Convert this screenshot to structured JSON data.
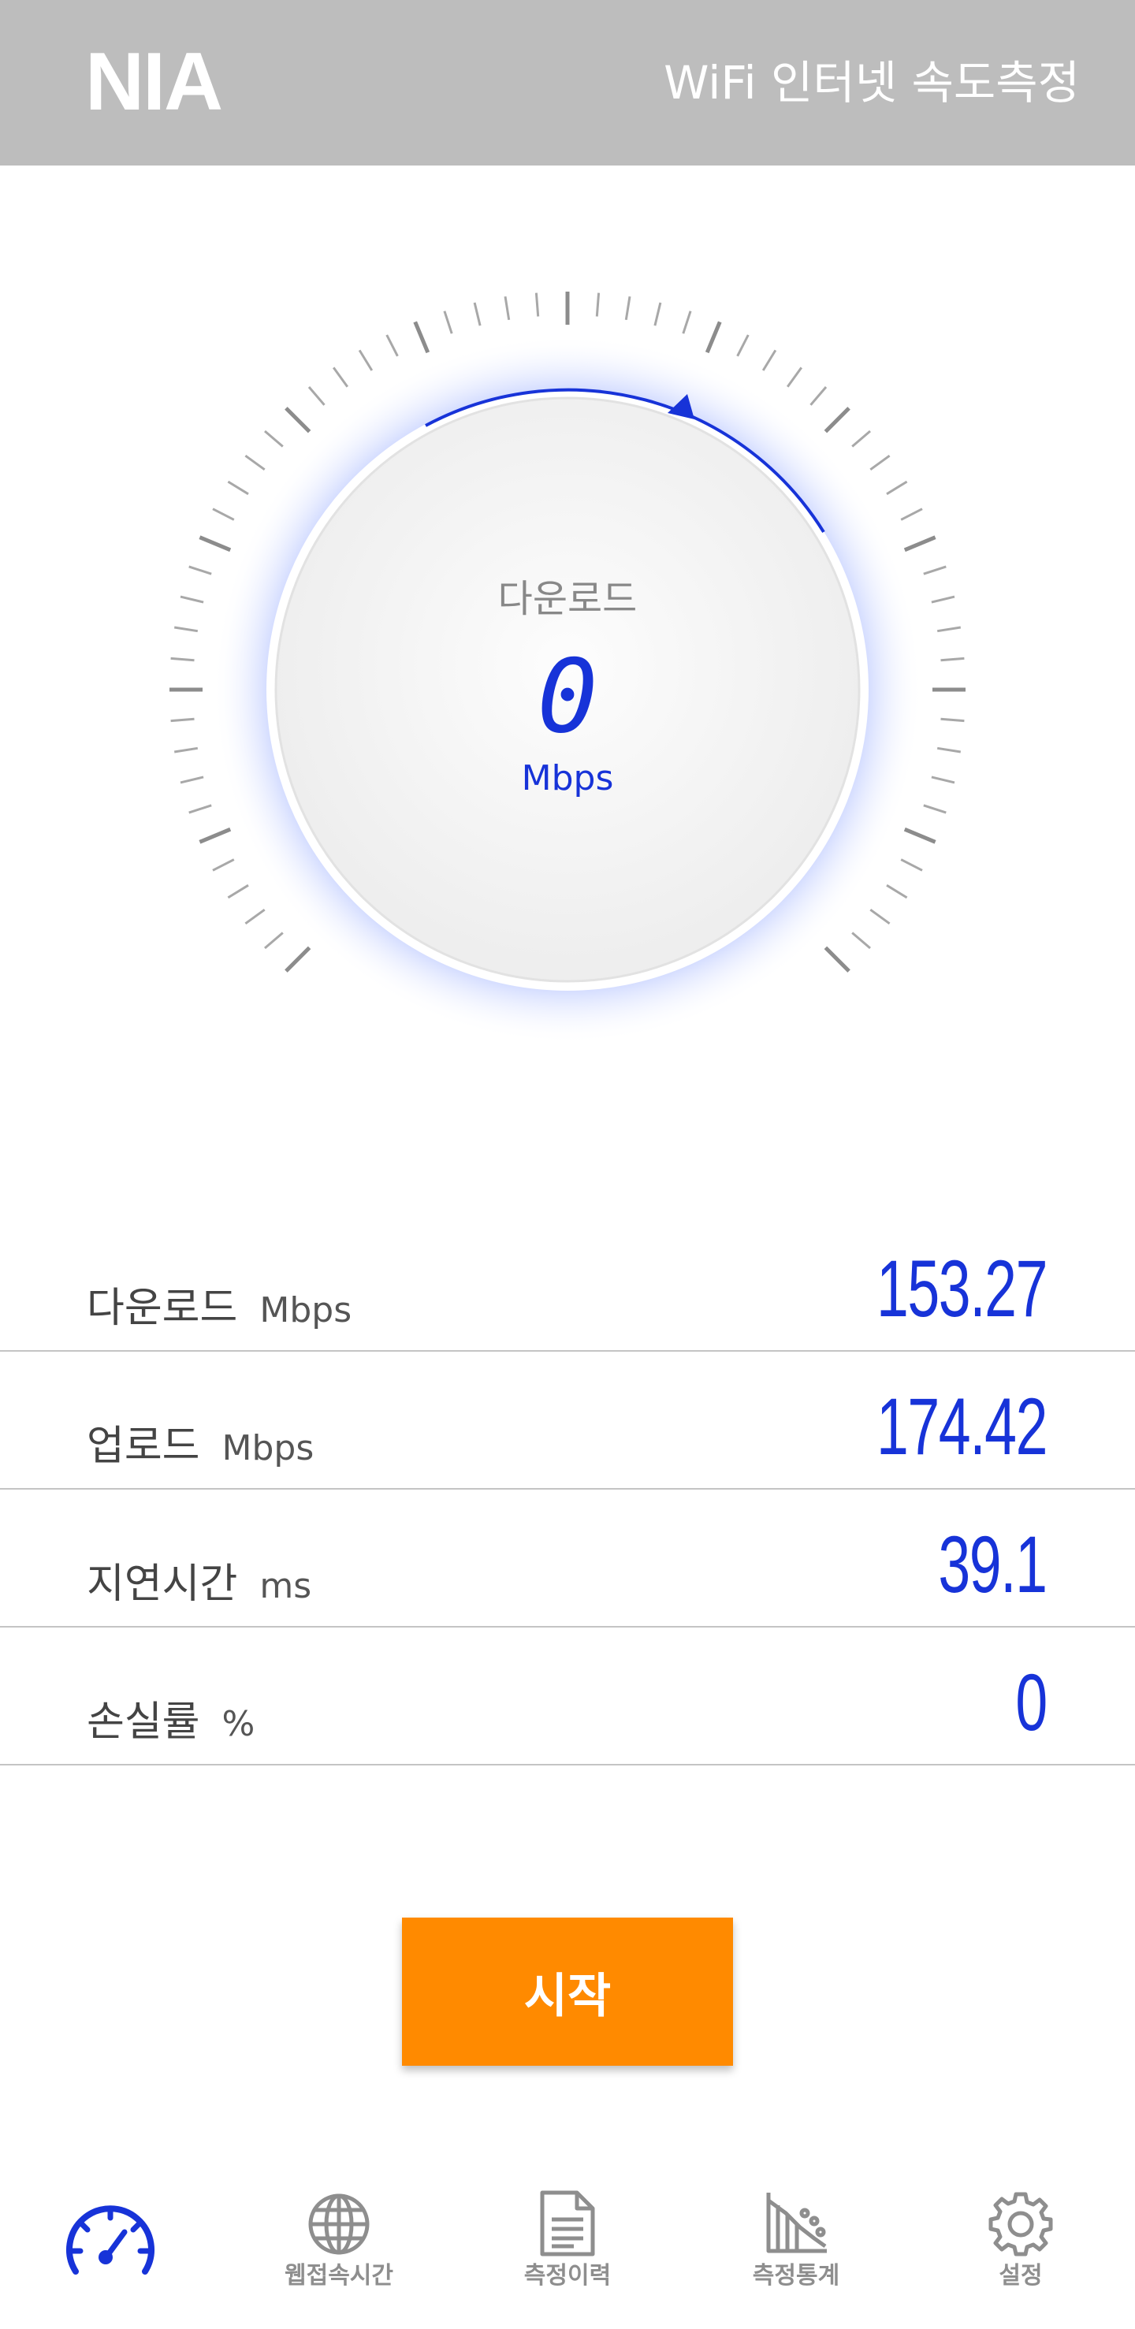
{
  "header": {
    "logo": "NIA",
    "title": "WiFi 인터넷 속도측정"
  },
  "gauge": {
    "label": "다운로드",
    "value": "0",
    "unit": "Mbps"
  },
  "results": [
    {
      "label": "다운로드",
      "unit": "Mbps",
      "value": "153.27"
    },
    {
      "label": "업로드",
      "unit": "Mbps",
      "value": "174.42"
    },
    {
      "label": "지연시간",
      "unit": "ms",
      "value": "39.1"
    },
    {
      "label": "손실률",
      "unit": "%",
      "value": "0"
    }
  ],
  "start_button": "시작",
  "nav": [
    {
      "label": "",
      "icon": "speedometer-icon",
      "active": true
    },
    {
      "label": "웹접속시간",
      "icon": "globe-icon"
    },
    {
      "label": "측정이력",
      "icon": "document-icon"
    },
    {
      "label": "측정통계",
      "icon": "statistics-icon"
    },
    {
      "label": "설정",
      "icon": "gear-icon"
    }
  ],
  "colors": {
    "accent": "#1733d8",
    "header": "#bdbdbd",
    "button": "#ff8a00"
  }
}
